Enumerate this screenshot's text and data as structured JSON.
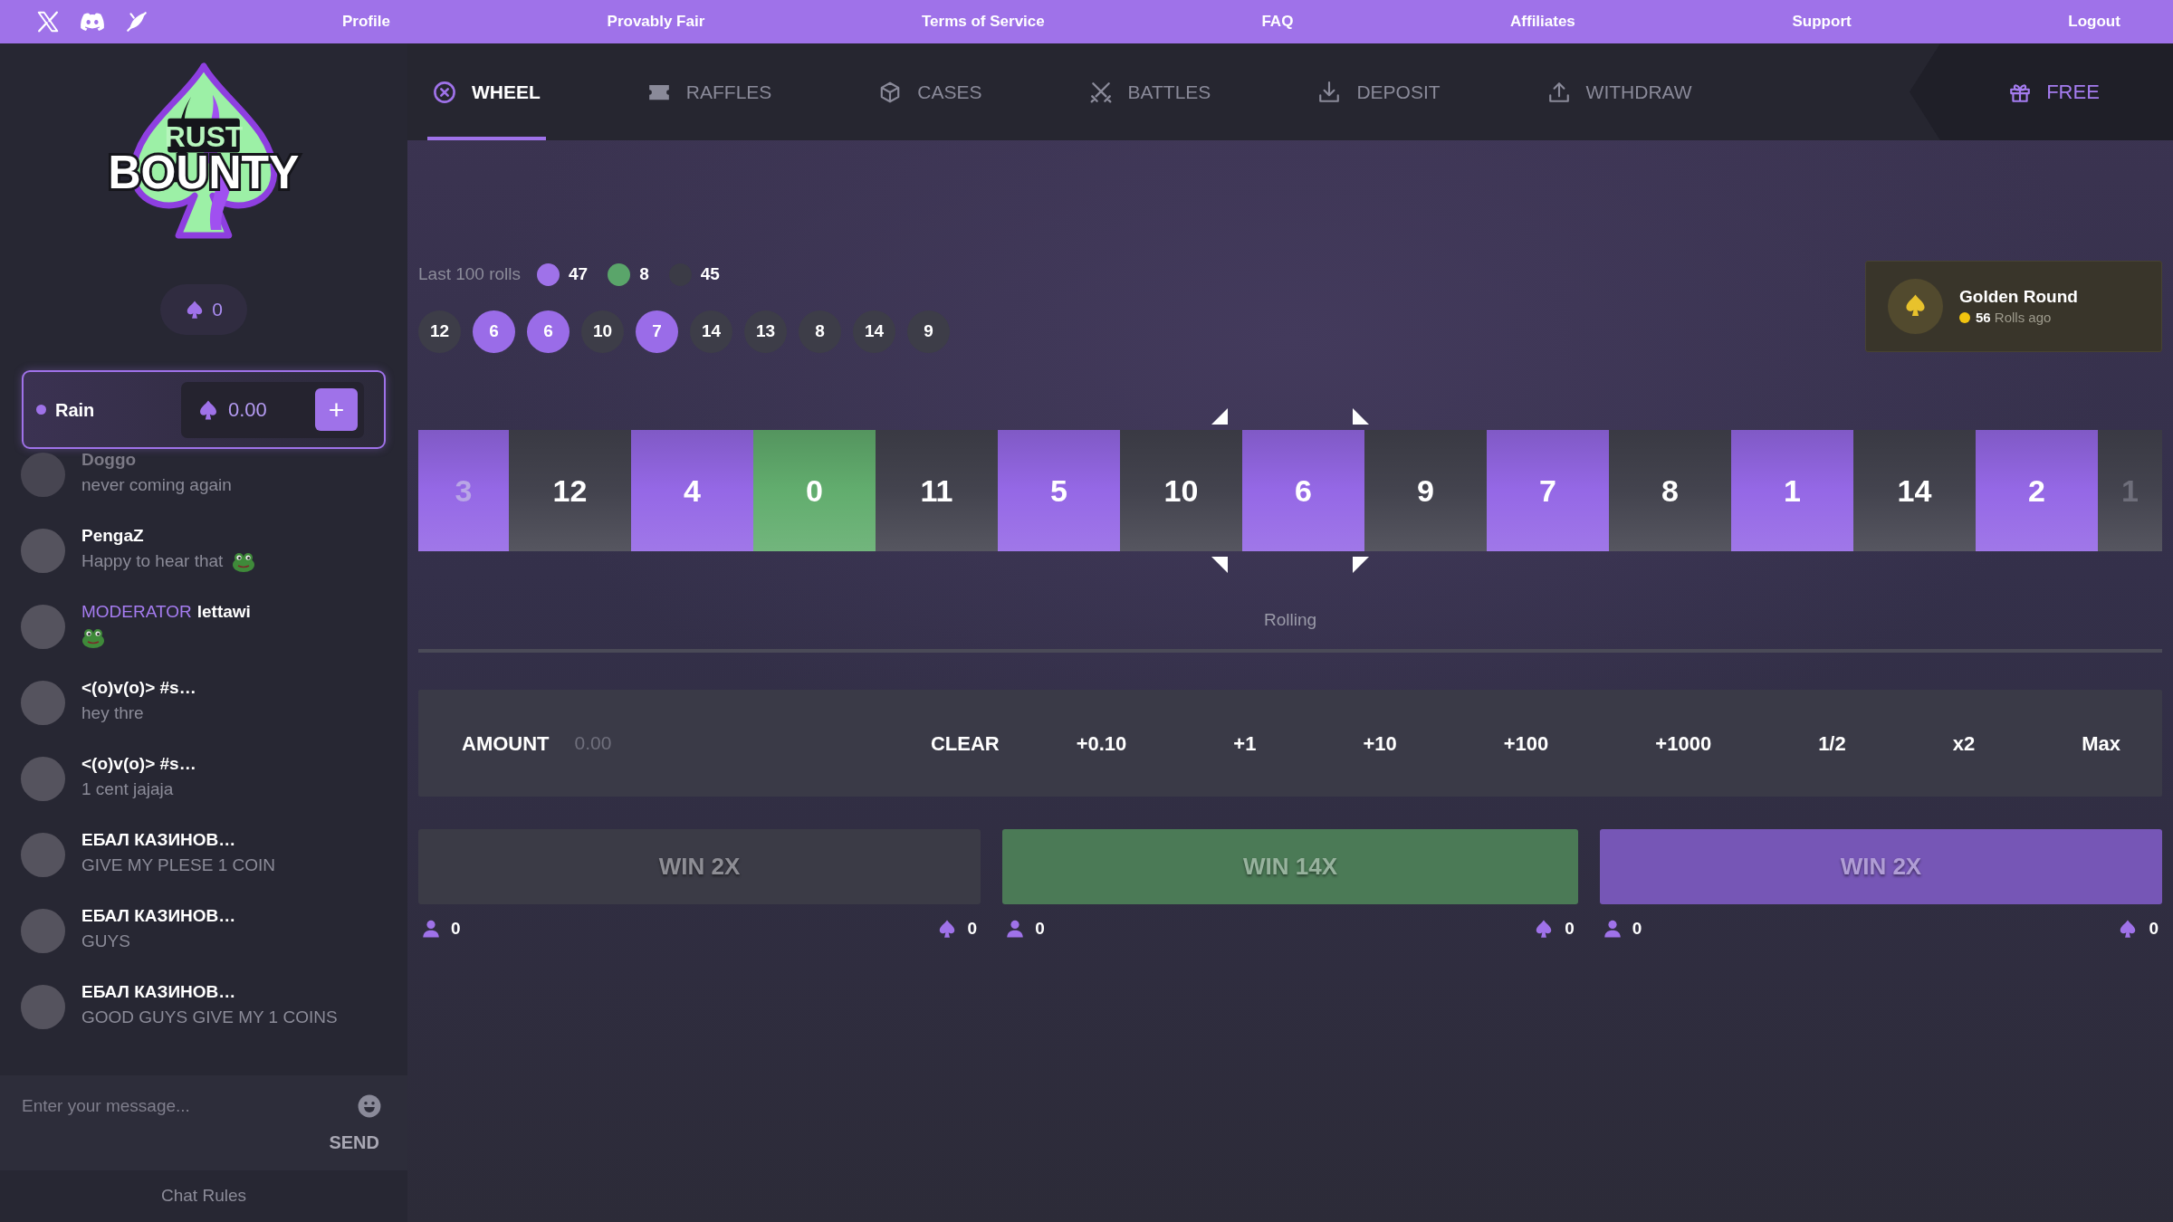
{
  "top_bar": {
    "links": [
      "Profile",
      "Provably Fair",
      "Terms of Service",
      "FAQ",
      "Affiliates",
      "Support",
      "Logout"
    ]
  },
  "sidebar": {
    "logo": {
      "line_1": "RUST",
      "line_2": "BOUNTY"
    },
    "balance": "0",
    "rain": {
      "label": "Rain",
      "amount": "0.00",
      "add_button": "+"
    },
    "chat": {
      "messages": [
        {
          "user": "Doggo",
          "text": "never coming again",
          "emote": false
        },
        {
          "user": "PengaZ",
          "text": "Happy to hear that",
          "emote": true
        },
        {
          "role": "MODERATOR",
          "user": "lettawi",
          "emote": true
        },
        {
          "user": "<(o)v(o)> #s…",
          "text": "hey thre",
          "emote": false
        },
        {
          "user": "<(o)v(o)> #s…",
          "text": "1 cent jajaja",
          "emote": false
        },
        {
          "user": "ЕБАЛ КАЗИНОВ…",
          "text": "GIVE MY PLESE 1 COIN",
          "emote": false
        },
        {
          "user": "ЕБАЛ КАЗИНОВ…",
          "text": "GUYS",
          "emote": false
        },
        {
          "user": "ЕБАЛ КАЗИНОВ…",
          "text": "GOOD GUYS GIVE MY 1 COINS",
          "emote": false
        }
      ],
      "input": {
        "placeholder": "Enter your message..."
      },
      "send_button": "SEND",
      "rules_link": "Chat Rules"
    }
  },
  "nav": {
    "tabs": [
      {
        "kind": "wheel",
        "label": "WHEEL",
        "selected": true
      },
      {
        "kind": "raffles",
        "label": "RAFFLES",
        "selected": false
      },
      {
        "kind": "cases",
        "label": "CASES",
        "selected": false
      },
      {
        "kind": "battles",
        "label": "BATTLES",
        "selected": false
      },
      {
        "kind": "deposit",
        "label": "DEPOSIT",
        "selected": false
      },
      {
        "kind": "withdraw",
        "label": "WITHDRAW",
        "selected": false
      }
    ],
    "free_button": "FREE"
  },
  "last_rolls": {
    "label": "Last 100 rolls",
    "counts": [
      {
        "color": "#9f72e9",
        "count": "47"
      },
      {
        "color": "#5aa56a",
        "count": "8"
      },
      {
        "color": "#3b3b46",
        "count": "45"
      }
    ],
    "history": [
      {
        "value": "12",
        "color": "#3d3d48"
      },
      {
        "value": "6",
        "color": "#9a6ce8"
      },
      {
        "value": "6",
        "color": "#9a6ce8"
      },
      {
        "value": "10",
        "color": "#3d3d48"
      },
      {
        "value": "7",
        "color": "#9a6ce8"
      },
      {
        "value": "14",
        "color": "#3d3d48"
      },
      {
        "value": "13",
        "color": "#3d3d48"
      },
      {
        "value": "8",
        "color": "#3d3d48"
      },
      {
        "value": "14",
        "color": "#3d3d48"
      },
      {
        "value": "9",
        "color": "#3d3d48"
      }
    ]
  },
  "golden_round": {
    "title": "Golden Round",
    "rolls_ago": "**56** Rolls ago"
  },
  "wheel": {
    "tiles": [
      {
        "value": "3",
        "color": "#9568e6"
      },
      {
        "value": "12",
        "color": "#43434e"
      },
      {
        "value": "4",
        "color": "#9568e6"
      },
      {
        "value": "0",
        "color": "#62ad6e"
      },
      {
        "value": "11",
        "color": "#43434e"
      },
      {
        "value": "5",
        "color": "#9568e6"
      },
      {
        "value": "10",
        "color": "#43434e"
      },
      {
        "value": "6",
        "color": "#9568e6"
      },
      {
        "value": "9",
        "color": "#43434e"
      },
      {
        "value": "7",
        "color": "#9568e6"
      },
      {
        "value": "8",
        "color": "#43434e"
      },
      {
        "value": "1",
        "color": "#9568e6"
      },
      {
        "value": "14",
        "color": "#43434e"
      },
      {
        "value": "2",
        "color": "#9568e6"
      },
      {
        "value": "1",
        "color": "#43434e"
      }
    ],
    "status": "Rolling",
    "level": 0
  },
  "bet": {
    "label": "AMOUNT",
    "placeholder": "0.00",
    "buttons": [
      "CLEAR",
      "+0.10",
      "+1",
      "+10",
      "+100",
      "+1000",
      "1/2",
      "x2",
      "Max"
    ]
  },
  "bet_options": [
    {
      "label": "WIN 2X",
      "color": "#3b3b46",
      "players": "0",
      "total": "0"
    },
    {
      "label": "WIN 14X",
      "color": "#4b7a56",
      "players": "0",
      "total": "0"
    },
    {
      "label": "WIN 2X",
      "color": "#7656b6",
      "players": "0",
      "total": "0"
    }
  ]
}
